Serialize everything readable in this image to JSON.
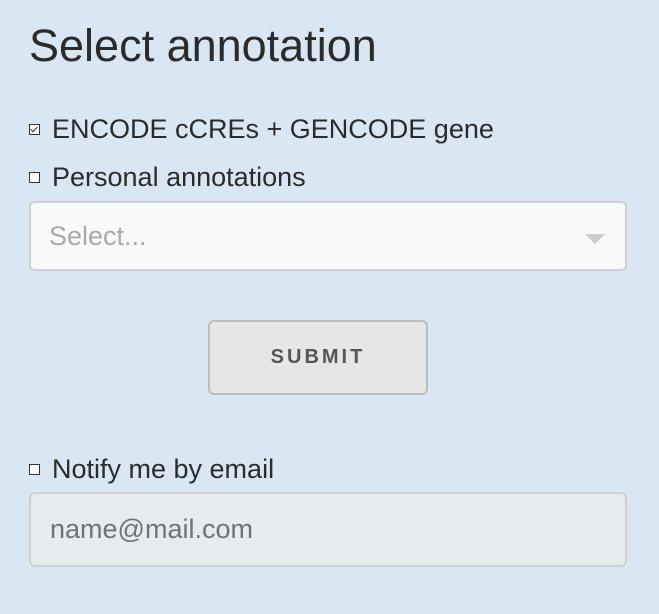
{
  "title": "Select annotation",
  "options": [
    {
      "label": "ENCODE cCREs + GENCODE gene",
      "checked": true
    },
    {
      "label": "Personal annotations",
      "checked": false
    }
  ],
  "select": {
    "placeholder": "Select..."
  },
  "submit_label": "SUBMIT",
  "notify": {
    "label": "Notify me by email",
    "checked": false
  },
  "email": {
    "placeholder": "name@mail.com",
    "value": ""
  }
}
